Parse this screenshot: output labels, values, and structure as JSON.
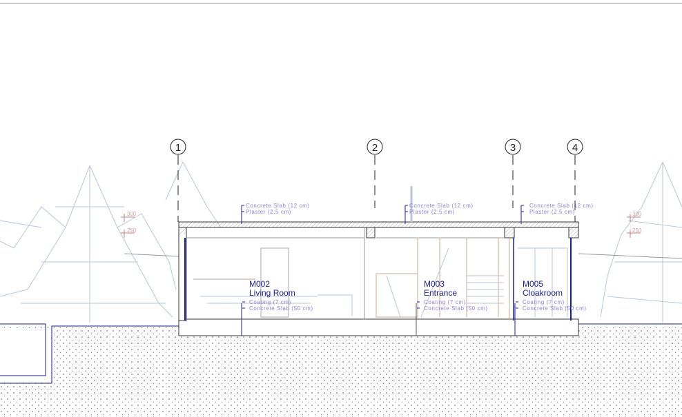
{
  "grid_axes": [
    "1",
    "2",
    "3",
    "4"
  ],
  "rooms": [
    {
      "id": "M002",
      "name": "Living Room",
      "floor": [
        "Coating (7 cm)",
        "Concrete Slab (50 cm)"
      ]
    },
    {
      "id": "M003",
      "name": "Entrance",
      "floor": [
        "Coating (7 cm)",
        "Concrete Slab (50 cm)"
      ]
    },
    {
      "id": "M005",
      "name": "Cloakroom",
      "floor": [
        "Coating (7 cm)",
        "Concrete Slab (50 cm)"
      ]
    }
  ],
  "roof_labels": [
    "Concrete Slab (12 cm)",
    "Plaster (2.5 cm)"
  ],
  "elevations": [
    "300",
    "250"
  ],
  "colors": {
    "annotation": "#8a7fe0",
    "room_text": "#1a1a9a",
    "wall_blue": "#1a1aa0",
    "tree": "#b8c6d8"
  }
}
